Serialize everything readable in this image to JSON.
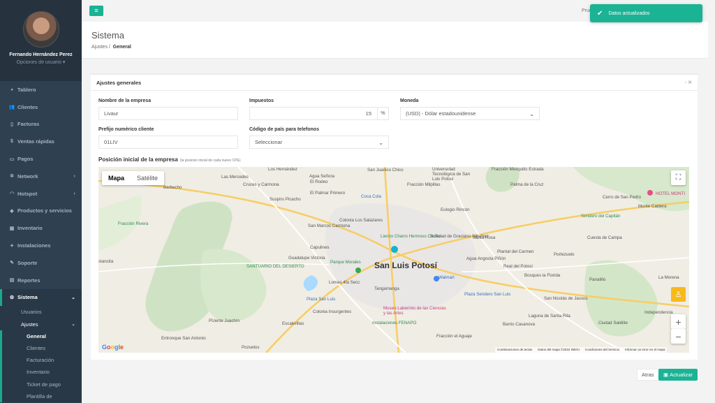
{
  "user": {
    "name": "Fernando Hernández Perez",
    "options_label": "Opciones de usuario",
    "top_label": "Prue"
  },
  "nav": [
    {
      "label": "Tablero",
      "icon": "tachometer-icon"
    },
    {
      "label": "Clientes",
      "icon": "users-icon"
    },
    {
      "label": "Facturas",
      "icon": "file-icon"
    },
    {
      "label": "Ventas rápidas",
      "icon": "dollar-icon"
    },
    {
      "label": "Pagos",
      "icon": "money-icon"
    },
    {
      "label": "Network",
      "icon": "sitemap-icon",
      "has_children": true
    },
    {
      "label": "Hotspot",
      "icon": "wifi-icon",
      "has_children": true
    },
    {
      "label": "Productos y servicios",
      "icon": "tag-icon"
    },
    {
      "label": "Inventario",
      "icon": "cubes-icon"
    },
    {
      "label": "Instalaciones",
      "icon": "wrench-icon"
    },
    {
      "label": "Soporte",
      "icon": "support-icon"
    },
    {
      "label": "Reportes",
      "icon": "report-icon"
    },
    {
      "label": "Sistema",
      "icon": "cogs-icon",
      "has_children": true,
      "active": true
    }
  ],
  "sistema_sub": {
    "usuarios": "Usuarios",
    "ajustes": "Ajustes",
    "ajustes_children": [
      "General",
      "Clientes",
      "Facturación",
      "Inventario",
      "Ticket de pago",
      "Plantilla de"
    ]
  },
  "toast": {
    "message": "Datos actualizados"
  },
  "page": {
    "title": "Sistema",
    "breadcrumb_parent": "Ajustes",
    "breadcrumb_current": "General"
  },
  "panel": {
    "title": "Ajustes generales",
    "company_name": {
      "label": "Nombre de la empresa",
      "value": "Livaur"
    },
    "taxes": {
      "label": "Impuestos",
      "value": "15",
      "suffix": "%"
    },
    "currency": {
      "label": "Moneda",
      "value": "(USD) - Dólar estadounidense"
    },
    "client_prefix": {
      "label": "Prefijo numérico cliente",
      "value": "01LIV"
    },
    "phone_code": {
      "label": "Código de país para telefonos",
      "value": "Seleccionar"
    },
    "map_title": "Posición inicial de la empresa",
    "map_hint": "(la posicion inicial de cada nuevo CPE)"
  },
  "map": {
    "tabs": [
      "Mapa",
      "Satélite"
    ],
    "selected_tab": "Mapa",
    "city": "San Luis Potosí",
    "labels": [
      "Barbecho",
      "Las Mercedes",
      "Los Hernández",
      "Agua Señora",
      "San Juanico Chico",
      "Universidad Tecnológica de San Luis Potosí",
      "Fracción Milpillas",
      "Fracción Mexquitic Estrada",
      "Palma de la Cruz",
      "Cruces y Carmona",
      "El Rodeo",
      "El Palmar Primero",
      "Suspiro Picacho",
      "Coca Cola",
      "Eulogio Rincón",
      "Cerro de San Pedro",
      "Monte Caldera",
      "HOTEL MONTI",
      "Sendero del Capitán",
      "Fracción Rivera",
      "San Marcos Carmona",
      "Colonia Los Salazares",
      "Lienzo Charro Hermoso Cariño",
      "Soledad de Graciano Sánchez",
      "Santa Rosa",
      "Cuesta de Campa",
      "Capulines",
      "Guadalupe Victoria",
      "Plantal del Carmen",
      "Portezuelo",
      "stancita",
      "Parque Morales",
      "Agua Angosta Piñón",
      "Real del Potosí",
      "SANTUARIO DEL DESIERTO",
      "Lomas 4ta Secc",
      "Tangamanga",
      "Walmart",
      "Bosques la Florida",
      "Panalillo",
      "La Morena",
      "Plaza San Luis",
      "Colonia Insurgentes",
      "Museo Laberinto de las Ciencias y las Artes",
      "Instalaciones FENAPO",
      "Plaza Sendero San Luis",
      "San Nicolás de Jassos",
      "Independencia",
      "PUente Juachín",
      "Escalerillas",
      "Laguna de Santa Rita",
      "Ciudad Satélite",
      "Barrio Casanova",
      "Entronque San Antonio",
      "Pozuelos",
      "Fracción el Aguaje",
      "San Luis Potosí"
    ],
    "attribution": [
      "Combinaciones de teclas",
      "Datos del mapa ©2022 INEGI",
      "Condiciones del Servicio",
      "Informar un error en el mapa"
    ],
    "logo": "Google"
  },
  "actions": {
    "back": "Atras",
    "save": "Actualizar"
  },
  "colors": {
    "accent": "#1ab394",
    "sidebar": "#2f4050"
  }
}
